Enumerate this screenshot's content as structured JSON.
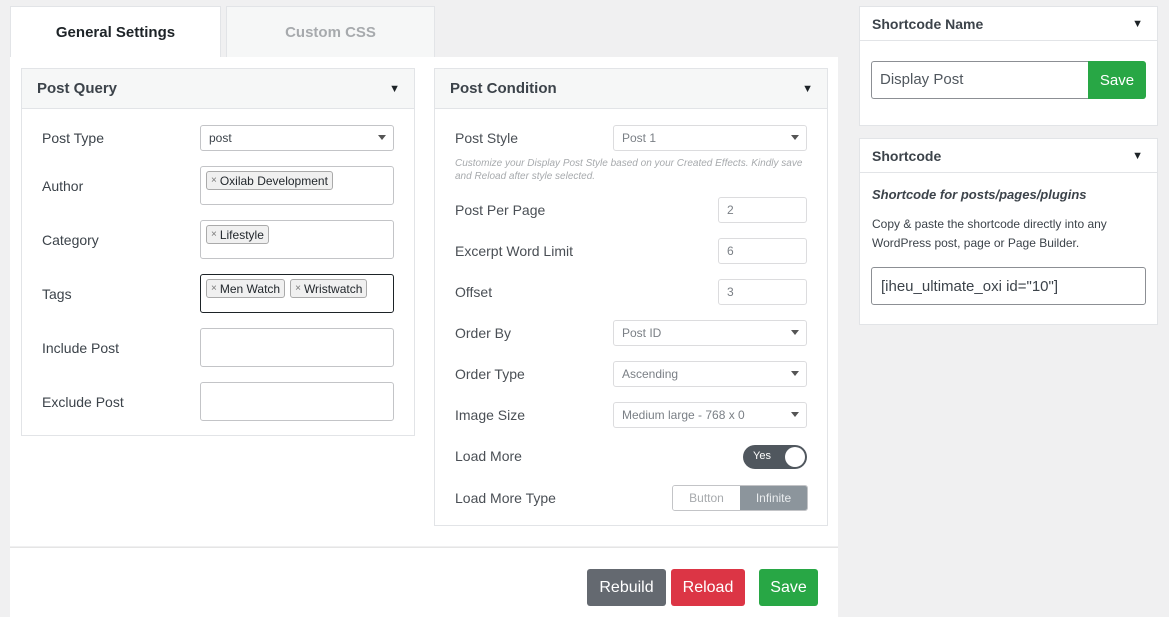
{
  "tabs": [
    {
      "label": "General Settings"
    },
    {
      "label": "Custom CSS"
    }
  ],
  "post_query": {
    "title": "Post Query",
    "post_type": {
      "label": "Post Type",
      "value": "post"
    },
    "author": {
      "label": "Author",
      "chips": [
        "Oxilab Development"
      ]
    },
    "category": {
      "label": "Category",
      "chips": [
        "Lifestyle"
      ]
    },
    "tags": {
      "label": "Tags",
      "chips": [
        "Men Watch",
        "Wristwatch"
      ]
    },
    "include_post": {
      "label": "Include Post",
      "value": ""
    },
    "exclude_post": {
      "label": "Exclude Post",
      "value": ""
    }
  },
  "post_condition": {
    "title": "Post Condition",
    "post_style": {
      "label": "Post Style",
      "value": "Post 1",
      "help": "Customize your Display Post Style based on your Created Effects. Kindly save and Reload after style selected."
    },
    "post_per_page": {
      "label": "Post Per Page",
      "value": "2"
    },
    "excerpt_word_limit": {
      "label": "Excerpt Word Limit",
      "value": "6"
    },
    "offset": {
      "label": "Offset",
      "value": "3"
    },
    "order_by": {
      "label": "Order By",
      "value": "Post ID"
    },
    "order_type": {
      "label": "Order Type",
      "value": "Ascending"
    },
    "image_size": {
      "label": "Image Size",
      "value": "Medium large - 768 x 0"
    },
    "load_more": {
      "label": "Load More",
      "value": "Yes"
    },
    "load_more_type": {
      "label": "Load More Type",
      "options": [
        "Button",
        "Infinite"
      ],
      "selected": "Infinite"
    }
  },
  "footer": {
    "rebuild": "Rebuild",
    "reload": "Reload",
    "save": "Save"
  },
  "shortcode_name": {
    "title": "Shortcode Name",
    "value": "Display Post",
    "save": "Save"
  },
  "shortcode": {
    "title": "Shortcode",
    "subtitle": "Shortcode for posts/pages/plugins",
    "description": "Copy & paste the shortcode directly into any WordPress post, page or Page Builder.",
    "value": "[iheu_ultimate_oxi id=\"10\"]"
  },
  "colors": {
    "rebuild": "#646970",
    "reload": "#dc3545",
    "save": "#28a745"
  }
}
